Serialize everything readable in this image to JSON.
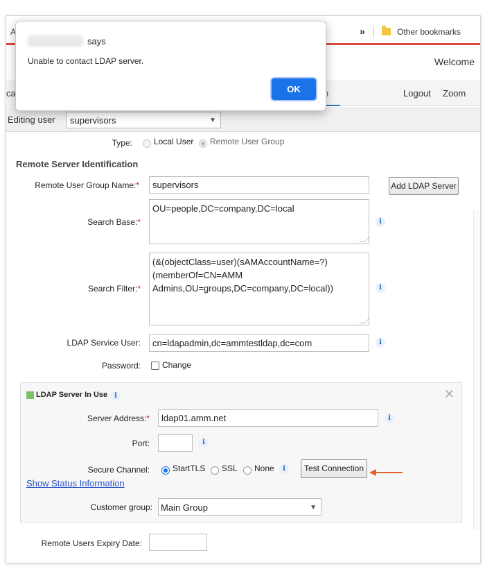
{
  "browser": {
    "left_letter": "A",
    "chevron": "»",
    "bookmark_folder_icon": "folder-icon",
    "other_bookmarks": "Other bookmarks"
  },
  "header": {
    "welcome": "Welcome",
    "nav_left_cut": "ca",
    "nav_admin_cut": "in",
    "logout": "Logout",
    "zoom": "Zoom"
  },
  "edit": {
    "label": "Editing user",
    "selected": "supervisors"
  },
  "form": {
    "type_label": "Type:",
    "type_local": "Local User",
    "type_remote": "Remote User Group",
    "section_title": "Remote Server Identification",
    "group_name_label": "Remote User Group Name:",
    "group_name_value": "supervisors",
    "add_ldap_button": "Add LDAP Server",
    "search_base_label": "Search Base:",
    "search_base_value": "OU=people,DC=company,DC=local",
    "search_filter_label": "Search Filter:",
    "search_filter_value": "(&(objectClass=user)(sAMAccountName=?)\n(memberOf=CN=AMM\nAdmins,OU=groups,DC=company,DC=local))",
    "service_user_label": "LDAP Service User:",
    "service_user_value": "cn=ldapadmin,dc=ammtestldap,dc=com",
    "password_label": "Password:",
    "password_change": "Change",
    "required_mark": "*",
    "info_glyph": "i"
  },
  "ldap": {
    "title": "LDAP Server In Use",
    "close_glyph": "✕",
    "server_address_label": "Server Address:",
    "server_address_value": "ldap01.amm.net",
    "port_label": "Port:",
    "port_value": "",
    "secure_channel_label": "Secure Channel:",
    "opt_starttls": "StartTLS",
    "opt_ssl": "SSL",
    "opt_none": "None",
    "test_button": "Test Connection",
    "status_link": "Show Status Information",
    "customer_group_label": "Customer group:",
    "customer_group_value": "Main Group"
  },
  "expiry": {
    "label": "Remote Users Expiry Date:",
    "value": ""
  },
  "dialog": {
    "says": "says",
    "message": "Unable to contact LDAP server.",
    "ok": "OK"
  },
  "colors": {
    "accent": "#1a73e8",
    "browser_red": "#d84b3e",
    "arrow": "#e8632c",
    "link": "#2852c9"
  }
}
